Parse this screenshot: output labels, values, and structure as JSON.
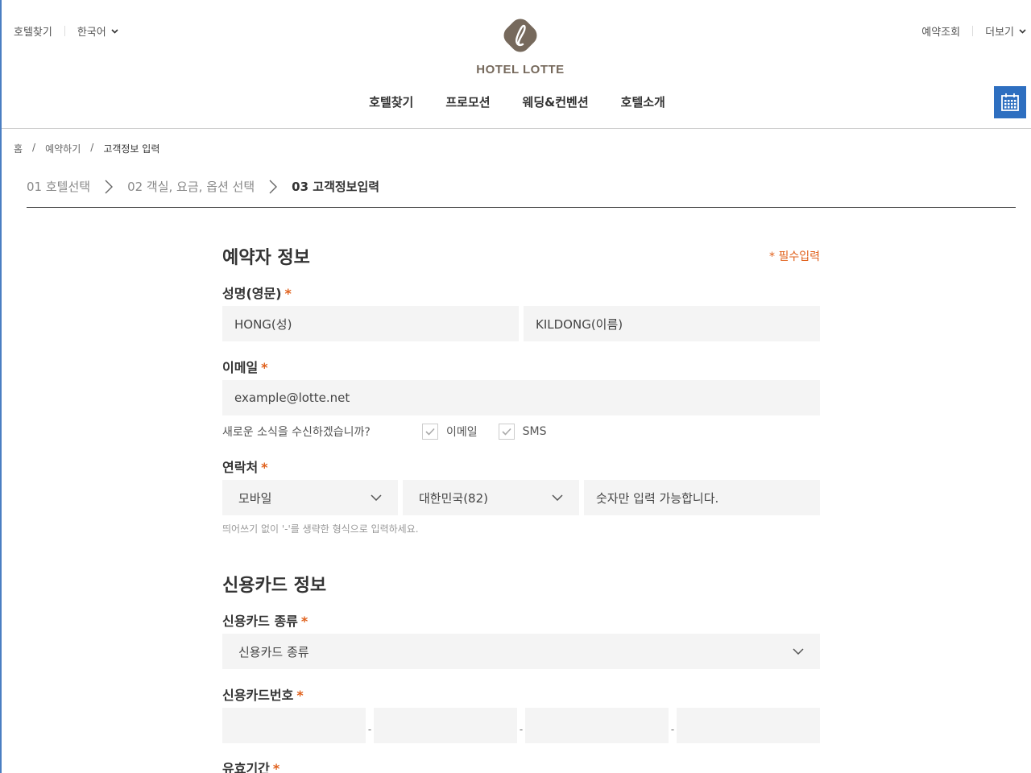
{
  "header": {
    "top_left": {
      "hotel_search": "호텔찾기",
      "language": "한국어"
    },
    "top_right": {
      "reservation_lookup": "예약조회",
      "more": "더보기"
    },
    "logo_text": "HOTEL LOTTE",
    "gnb": [
      "호텔찾기",
      "프로모션",
      "웨딩&컨벤션",
      "호텔소개"
    ]
  },
  "breadcrumb": [
    "홈",
    "예약하기",
    "고객정보 입력"
  ],
  "breadcrumb_sep": "/",
  "steps": [
    "01 호텔선택",
    "02 객실, 요금, 옵션 선택",
    "03 고객정보입력"
  ],
  "booker": {
    "title": "예약자 정보",
    "required_note": "* 필수입력",
    "name_label": "성명(영문)",
    "last_name_placeholder": "HONG(성)",
    "first_name_placeholder": "KILDONG(이름)",
    "email_label": "이메일",
    "email_placeholder": "example@lotte.net",
    "newsletter_question": "새로운 소식을 수신하겠습니까?",
    "newsletter_email": "이메일",
    "newsletter_sms": "SMS",
    "contact_label": "연락처",
    "phone_type": "모바일",
    "country_code": "대한민국(82)",
    "phone_placeholder": "숫자만 입력 가능합니다.",
    "phone_hint": "띄어쓰기 없이 '-'를 생략한 형식으로 입력하세요."
  },
  "card": {
    "title": "신용카드 정보",
    "type_label": "신용카드 종류",
    "type_placeholder": "신용카드 종류",
    "number_label": "신용카드번호",
    "expiry_label": "유효기간"
  },
  "star": "*",
  "dash": "-",
  "colors": {
    "accent_blue": "#2e6fc0",
    "required_orange": "#e0601b",
    "logo_brown": "#76695c",
    "input_bg": "#f4f4f4"
  }
}
